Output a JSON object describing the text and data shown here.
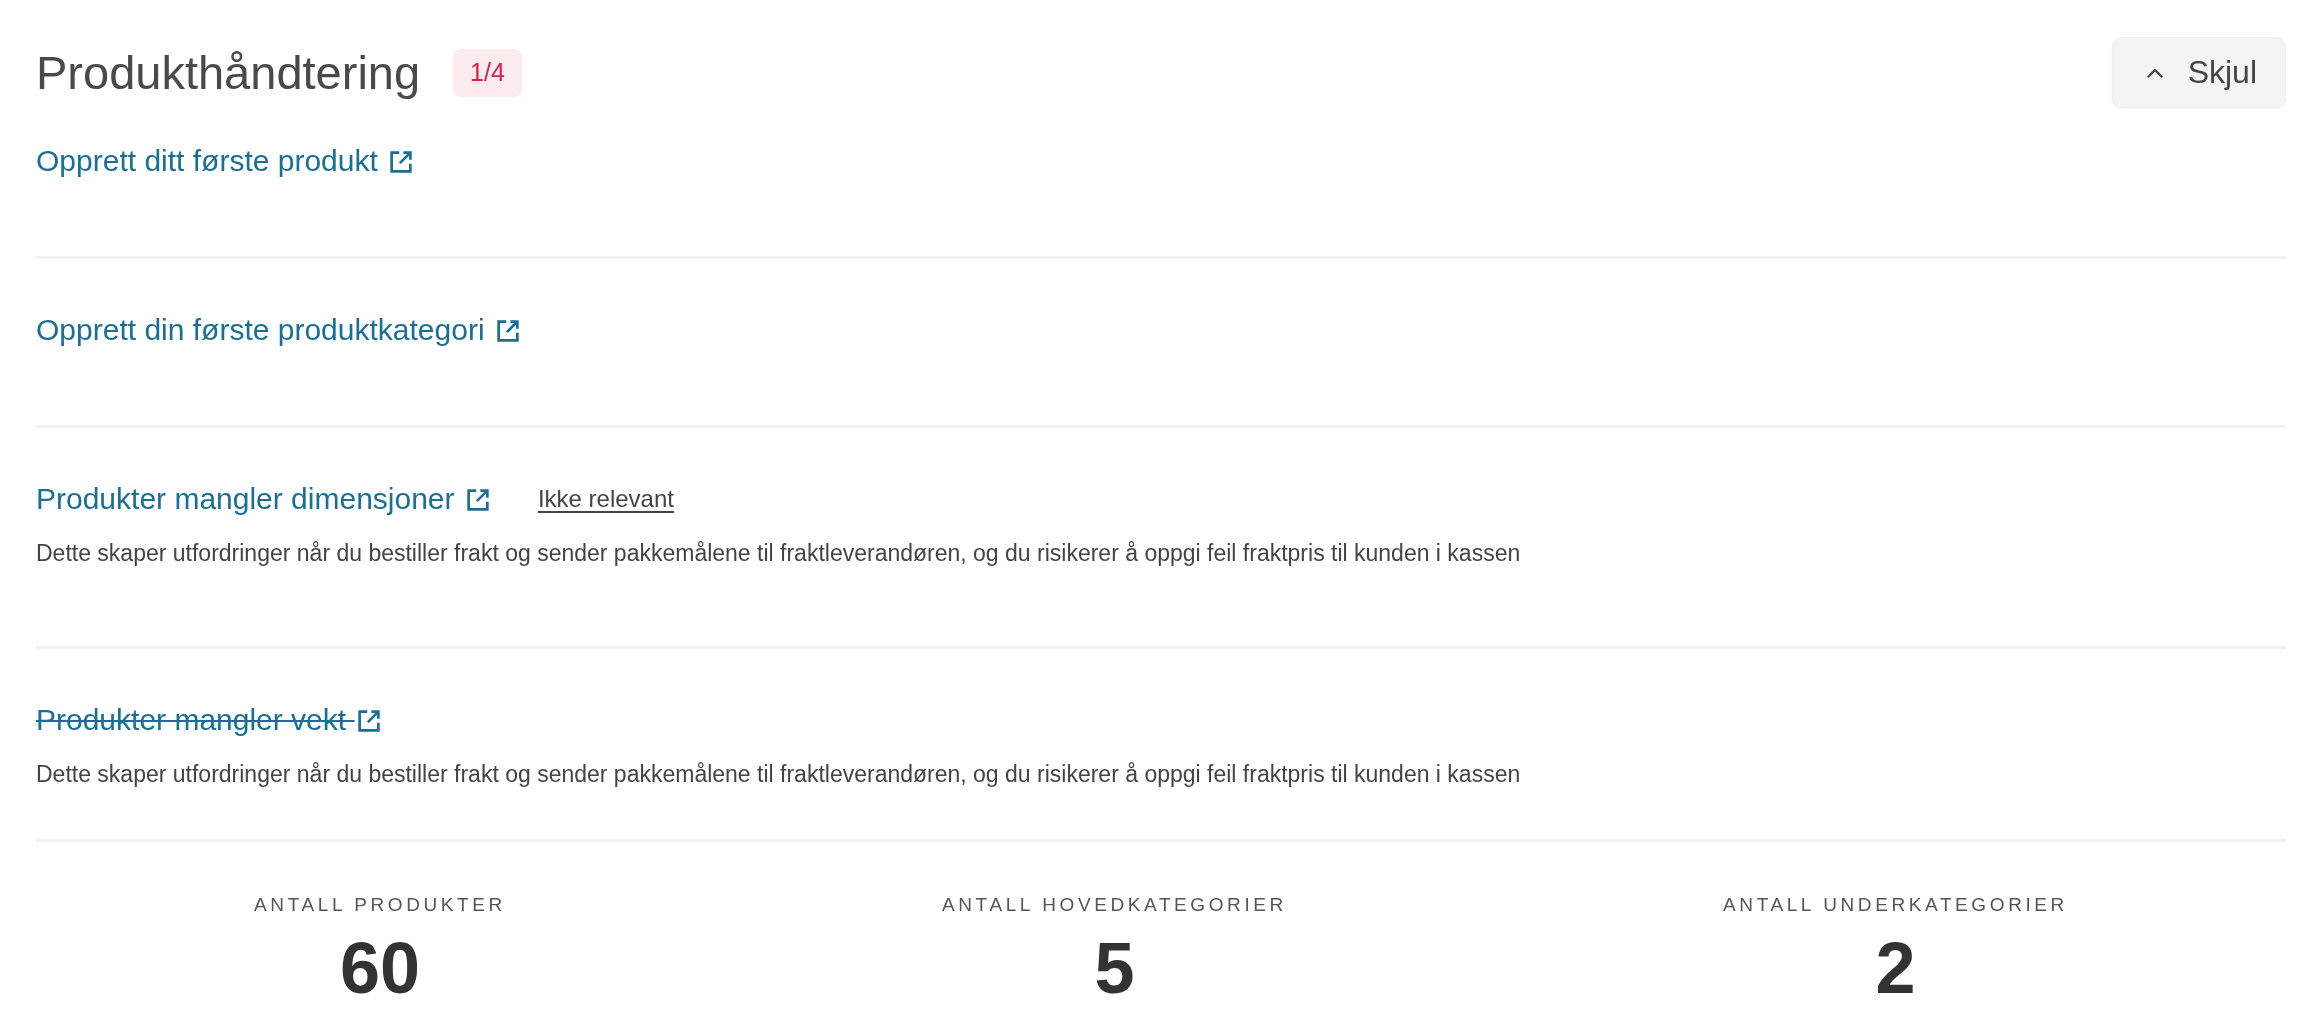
{
  "header": {
    "title": "Produkthåndtering",
    "badge": "1/4",
    "toggle_button": {
      "label": "Skjul",
      "expanded": true
    }
  },
  "tasks": [
    {
      "title": "Opprett ditt første produkt",
      "done": false
    },
    {
      "title": "Opprett din første produktkategori",
      "done": false
    },
    {
      "title": "Produkter mangler dimensjoner",
      "done": false,
      "action": "Ikke relevant",
      "description": "Dette skaper utfordringer når du bestiller frakt og sender pakkemålene til fraktleverandøren, og du risikerer å oppgi feil fraktpris til kunden i kassen"
    },
    {
      "title": "Produkter mangler vekt",
      "done": true,
      "description": "Dette skaper utfordringer når du bestiller frakt og sender pakkemålene til fraktleverandøren, og du risikerer å oppgi feil fraktpris til kunden i kassen"
    }
  ],
  "stats": [
    {
      "label": "ANTALL PRODUKTER",
      "value": "60"
    },
    {
      "label": "ANTALL HOVEDKATEGORIER",
      "value": "5"
    },
    {
      "label": "ANTALL UNDERKATEGORIER",
      "value": "2"
    }
  ]
}
